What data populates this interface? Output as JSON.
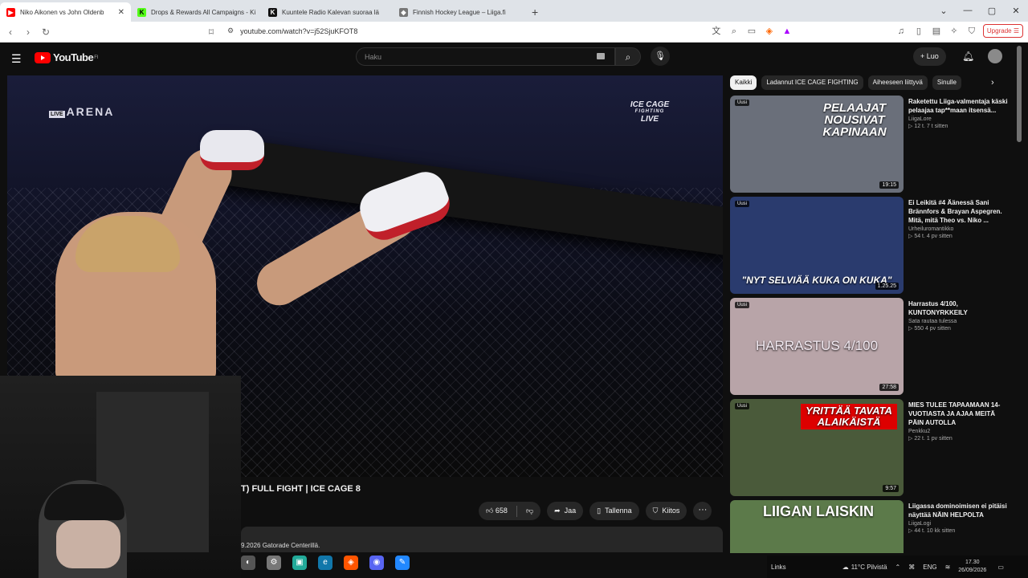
{
  "browser": {
    "tabs": [
      {
        "title": "Niko Aikonen vs John Oldenb",
        "icon": "youtube-icon",
        "color": "#ff0000"
      },
      {
        "title": "Drops & Rewards All Campaigns - Ki",
        "icon": "kick-icon",
        "color": "#53fc18"
      },
      {
        "title": "Kuuntele Radio Kalevan suoraa lä",
        "icon": "kaleva-icon",
        "color": "#111111"
      },
      {
        "title": "Finnish Hockey League – Liiga.fi",
        "icon": "liiga-icon",
        "color": "#555555"
      }
    ],
    "url": "youtube.com/watch?v=j52SjuKFOT8",
    "upgrade_label": "Upgrade"
  },
  "youtube": {
    "logo_text": "YouTube",
    "region": "FI",
    "search_placeholder": "Haku",
    "create_label": "Luo"
  },
  "video": {
    "overlay_left": "ARENA",
    "overlay_live": "LIVE",
    "overlay_right_top": "ICE CAGE",
    "overlay_right_mid": "FIGHTING",
    "overlay_right_bottom": "LIVE",
    "title": "T) FULL FIGHT | ICE CAGE 8",
    "likes": "658",
    "share_label": "Jaa",
    "save_label": "Tallenna",
    "thanks_label": "Kiitos",
    "description": "9.2026 Gatorade Centerillä."
  },
  "chips": [
    "Kaikki",
    "Ladannut ICE CAGE FIGHTING",
    "Aiheeseen liittyvä",
    "Sinulle"
  ],
  "recommendations": [
    {
      "badge": "Uusi",
      "thumb_text": "PELAAJAT NOUSIVAT KAPINAAN",
      "duration": "19:15",
      "title": "Raketettu Liiga-valmentaja käski pelaajaa tap**maan itsensä...",
      "channel": "LiigaLore",
      "stats": "▷ 12 t.  7 t sitten",
      "bg": "#6a6f7a"
    },
    {
      "badge": "Uusi",
      "thumb_text": "\"NYT SELVIÄÄ KUKA ON KUKA\"",
      "duration": "1.25.25",
      "title": "Ei Leikitä #4 Äänessä Sani Brännfors & Brayan Aspegren. Mitä, mitä Theo vs. Niko ...",
      "channel": "Urheiluromantikko",
      "stats": "▷ 54 t.  4 pv sitten",
      "bg": "#2a3b6e"
    },
    {
      "badge": "Uusi",
      "thumb_text": "HARRASTUS 4/100",
      "duration": "27:58",
      "title": "Harrastus 4/100, KUNTONYRKKEILY",
      "channel": "Sata rautaa tulessa",
      "stats": "▷ 550  4 pv sitten",
      "bg": "#b8a4a8"
    },
    {
      "badge": "Uusi",
      "thumb_text": "YRITTÄÄ TAVATA ALAIKÄISTÄ",
      "duration": "9:57",
      "title": "MIES TULEE TAPAAMAAN 14-VUOTIASTA JA AJAA MEITÄ PÄIN AUTOLLA",
      "channel": "Penkku2",
      "stats": "▷ 22 t.  1 pv sitten",
      "bg": "#4a5a3a"
    },
    {
      "badge": "",
      "thumb_text": "LIIGAN LAISKIN",
      "duration": "",
      "title": "Liigassa dominoimisen ei pitäisi näyttää NÄIN HELPOLTA",
      "channel": "LiigaLogi",
      "stats": "▷ 44 t.  10 kk sitten",
      "bg": "#5c7a4a"
    }
  ],
  "taskbar": {
    "links_label": "Links",
    "weather": "11°C  Pilvistä",
    "lang": "ENG",
    "time": "17.30",
    "date": "26/09/2026"
  }
}
